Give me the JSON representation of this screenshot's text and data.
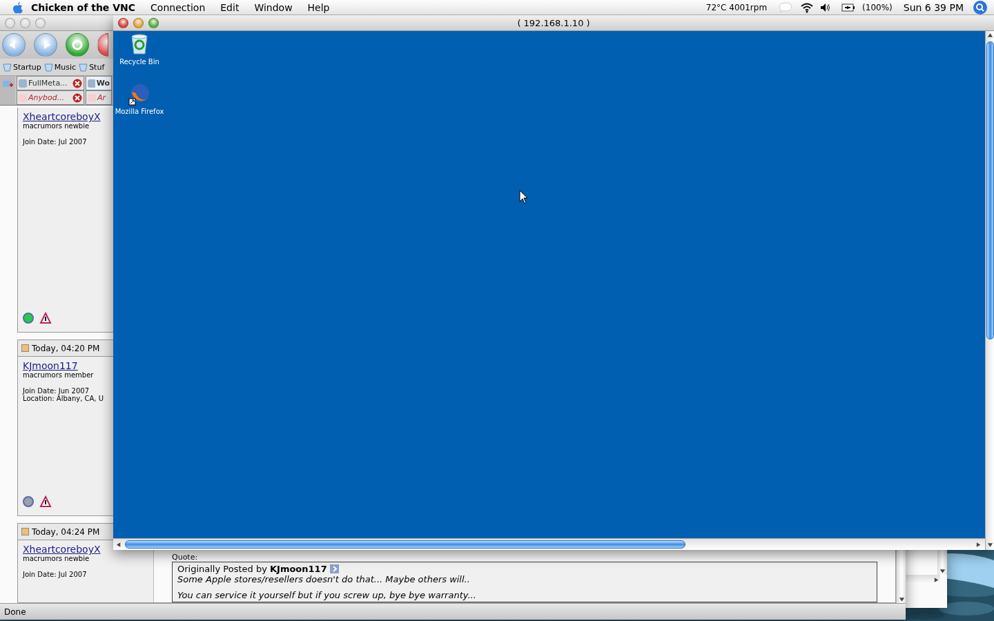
{
  "menu_bar": {
    "app_name": "Chicken of the VNC",
    "menus": [
      "Connection",
      "Edit",
      "Window",
      "Help"
    ],
    "sensors": "72°C 4001rpm",
    "battery": "(100%)",
    "clock": "Sun 6 39 PM"
  },
  "browser_window": {
    "bookmarks": [
      "Startup",
      "Music",
      "Stuf"
    ],
    "tab_rows": [
      [
        {
          "label": "FullMeta...",
          "selected": false,
          "unread": false
        },
        {
          "label": "Wo",
          "selected": true,
          "unread": false
        }
      ],
      [
        {
          "label": "Anybod...",
          "selected": false,
          "unread": true
        },
        {
          "label": "Ar",
          "selected": false,
          "unread": true
        }
      ]
    ],
    "posts": [
      {
        "user": "XheartcoreboyX",
        "rank": "macrumors newbie",
        "details": [
          "Join Date: Jul 2007"
        ],
        "online": true
      },
      {
        "date": "Today, 04:20 PM",
        "user": "KJmoon117",
        "rank": "macrumors member",
        "details": [
          "Join Date: Jun 2007",
          "Location: Albany, CA, U"
        ],
        "online": false
      },
      {
        "date": "Today, 04:24 PM",
        "user": "XheartcoreboyX",
        "rank": "macrumors newbie",
        "details": [
          "Join Date: Jul 2007"
        ],
        "quote": {
          "label": "Quote:",
          "attribution": "Originally Posted by **KJmoon117**",
          "lines": [
            "Some Apple stores/resellers doesn't do that... Maybe others will..",
            "You can service it yourself but if you screw up, bye bye warranty..."
          ]
        }
      }
    ],
    "status_bar": "Done"
  },
  "vnc_window": {
    "title": "( 192.168.1.10 )",
    "desktop_icons": [
      {
        "label": "Recycle Bin",
        "kind": "recycle-bin"
      },
      {
        "label": "Mozilla Firefox",
        "kind": "firefox"
      }
    ]
  }
}
